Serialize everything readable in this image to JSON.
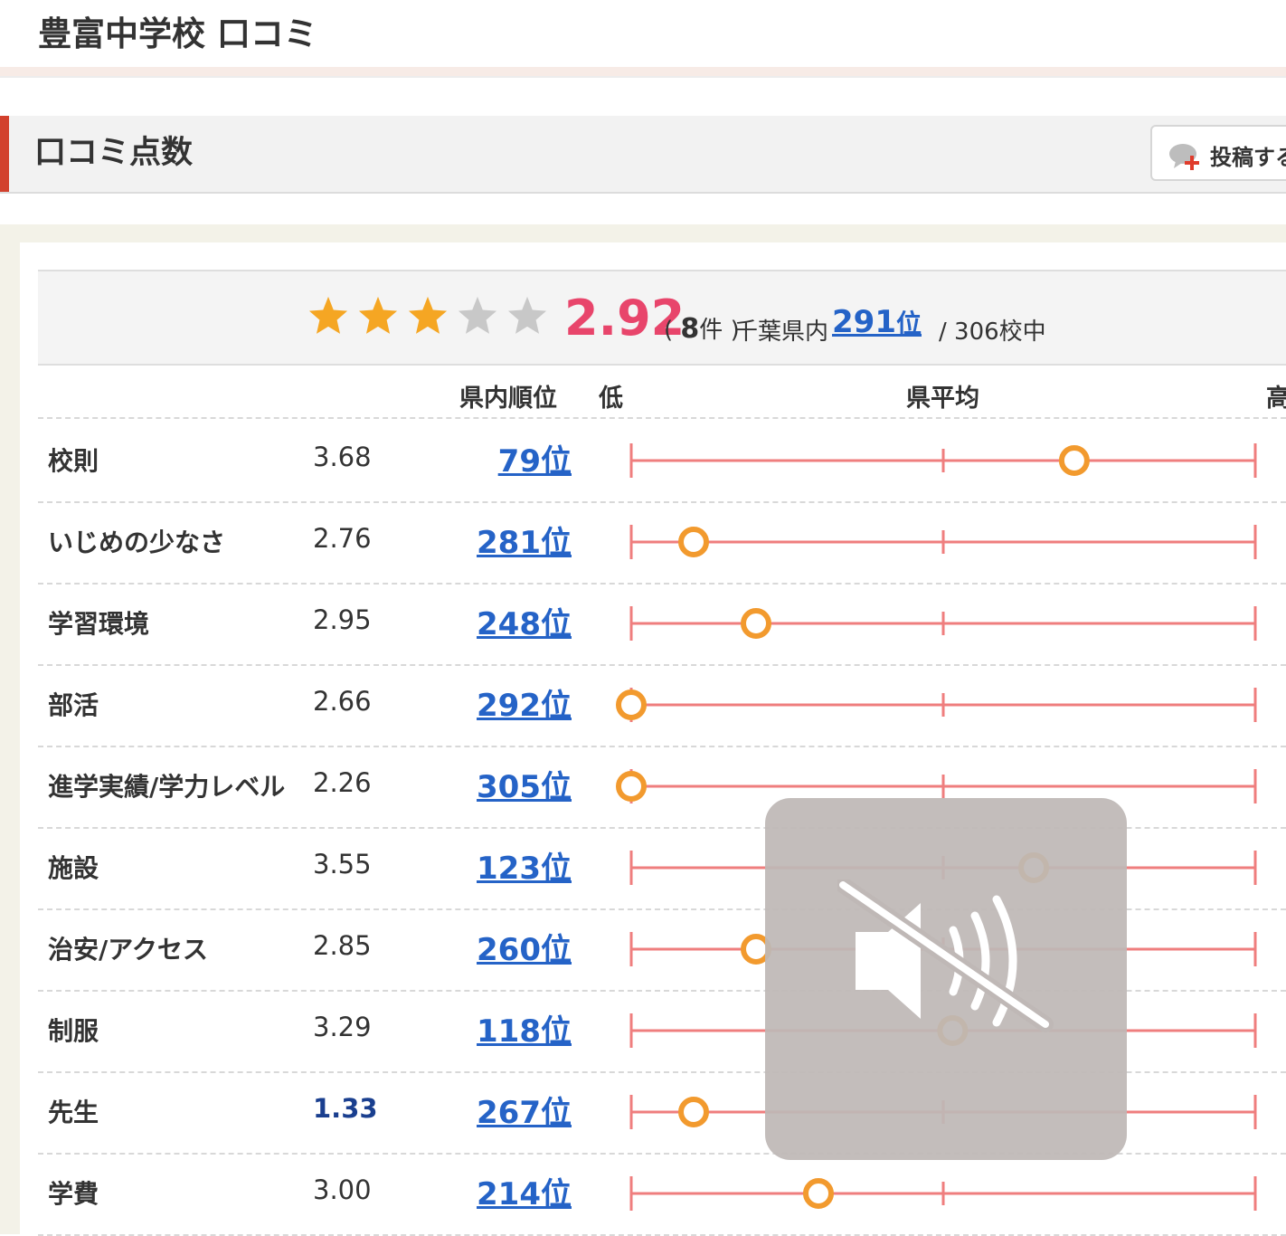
{
  "page": {
    "title": "豊富中学校 口コミ"
  },
  "section": {
    "title": "口コミ点数",
    "post_button": "投稿する"
  },
  "summary": {
    "rating": 2.92,
    "stars_filled": 3,
    "stars_total": 5,
    "score": "2.92",
    "count_open": "(",
    "count_num": "8",
    "count_unit": "件",
    "count_close": ")",
    "pref_label": "千葉県内",
    "pref_rank_num": "291",
    "pref_rank_unit": "位",
    "pref_total": "/ 306校中"
  },
  "table": {
    "headers": {
      "rank": "県内順位",
      "low": "低",
      "avg": "県平均",
      "high": "高"
    },
    "scale_min": 2.26,
    "scale_avg": 3.26,
    "scale_max": 4.26,
    "rows": [
      {
        "label": "校則",
        "score": "3.68",
        "rank": "79位",
        "value": 3.68
      },
      {
        "label": "いじめの少なさ",
        "score": "2.76",
        "rank": "281位",
        "value": 2.46
      },
      {
        "label": "学習環境",
        "score": "2.95",
        "rank": "248位",
        "value": 2.66
      },
      {
        "label": "部活",
        "score": "2.66",
        "rank": "292位",
        "value": 2.26
      },
      {
        "label": "進学実績/学力レベル",
        "score": "2.26",
        "rank": "305位",
        "value": 2.26
      },
      {
        "label": "施設",
        "score": "3.55",
        "rank": "123位",
        "value": 3.55
      },
      {
        "label": "治安/アクセス",
        "score": "2.85",
        "rank": "260位",
        "value": 2.66
      },
      {
        "label": "制服",
        "score": "3.29",
        "rank": "118位",
        "value": 3.29
      },
      {
        "label": "先生",
        "score": "1.33",
        "rank": "267位",
        "value": 2.46,
        "low": true
      },
      {
        "label": "学費",
        "score": "3.00",
        "rank": "214位",
        "value": 2.86
      }
    ]
  },
  "colors": {
    "accent": "#d2402d",
    "score": "#e8456b",
    "link": "#2563c7",
    "scale_line": "#ef7e7e",
    "marker": "#f29a2e",
    "star_on": "#f5a623",
    "star_off": "#c8c8c8"
  },
  "overlay": {
    "icon": "speaker-muted-icon"
  }
}
